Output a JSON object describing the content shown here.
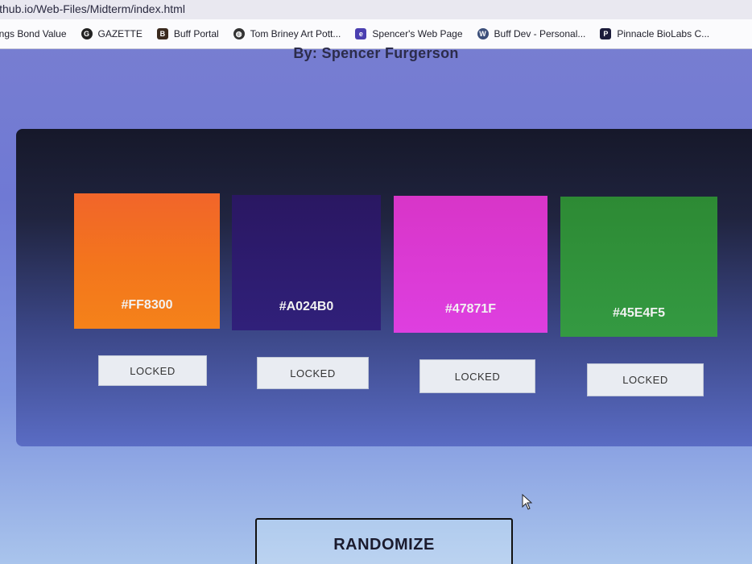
{
  "browser": {
    "url": "ithub.io/Web-Files/Midterm/index.html",
    "bookmarks": [
      {
        "label": "ings Bond Value",
        "icon": "none"
      },
      {
        "label": "GAZETTE",
        "icon": "gazette-icon"
      },
      {
        "label": "Buff Portal",
        "icon": "buff-portal-icon"
      },
      {
        "label": "Tom Briney Art Pott...",
        "icon": "globe-icon"
      },
      {
        "label": "Spencer's Web Page",
        "icon": "web-page-icon"
      },
      {
        "label": "Buff Dev - Personal...",
        "icon": "wordpress-icon"
      },
      {
        "label": "Pinnacle BioLabs C...",
        "icon": "pinnacle-icon"
      }
    ]
  },
  "page": {
    "byline": "By: Spencer Furgerson",
    "swatches": [
      {
        "hex": "#FF8300",
        "color": "#f4731c",
        "lock_label": "LOCKED"
      },
      {
        "hex": "#A024B0",
        "color": "#2d1a6a",
        "lock_label": "LOCKED"
      },
      {
        "hex": "#47871F",
        "color": "#d63ad6",
        "lock_label": "LOCKED"
      },
      {
        "hex": "#45E4F5",
        "color": "#2f8f38",
        "lock_label": "LOCKED"
      }
    ],
    "randomize_label": "RANDOMIZE"
  }
}
